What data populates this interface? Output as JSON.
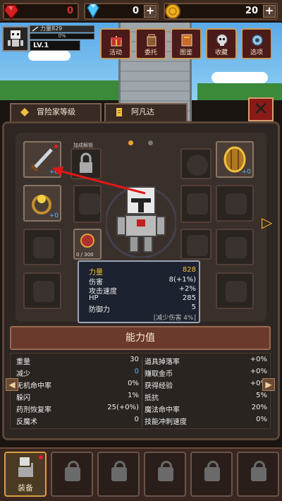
{
  "resources": {
    "gems": "0",
    "diamonds": "0",
    "coins": "20"
  },
  "profile": {
    "stat_name": "力量",
    "stat_value": "829",
    "xp_percent": "0%",
    "level": "LV.1"
  },
  "menu": [
    {
      "label": "活动",
      "icon": "gift-icon"
    },
    {
      "label": "委托",
      "icon": "backpack-icon"
    },
    {
      "label": "图鉴",
      "icon": "book-icon"
    },
    {
      "label": "收藏",
      "icon": "skull-icon"
    },
    {
      "label": "选项",
      "icon": "gear-icon"
    }
  ],
  "tabs": {
    "adventurer": "冒险家等级",
    "name": "阿凡达"
  },
  "equipment": {
    "sword_plus": "+0",
    "shield_plus": "+0",
    "ring_plus": "+0",
    "unlock_text": "加成解锁",
    "potion_count": "0 / 300"
  },
  "tooltip": {
    "title": "力量",
    "title_value": "828",
    "rows": [
      {
        "k": "伤害",
        "v": "8(+1%)"
      },
      {
        "k": "攻击速度",
        "v": "+2%"
      },
      {
        "k": "HP",
        "v": "285"
      },
      {
        "k": "防御力",
        "v": "5"
      }
    ],
    "note": "[减少伤害 4%]"
  },
  "ability": {
    "header": "能力值",
    "left": [
      {
        "k": "重量",
        "v": "30"
      },
      {
        "k": "减少",
        "v": "0"
      },
      {
        "k": "无机命中率",
        "v": "0%"
      },
      {
        "k": "躲闪",
        "v": "1%"
      },
      {
        "k": "药剂恢复率",
        "v": "25(+0%)"
      },
      {
        "k": "反魔术",
        "v": "0"
      }
    ],
    "right": [
      {
        "k": "道具掉落率",
        "v": "+0%"
      },
      {
        "k": "赚取金币",
        "v": "+0%"
      },
      {
        "k": "获得经验",
        "v": "+0%"
      },
      {
        "k": "抵抗",
        "v": "5%"
      },
      {
        "k": "魔法命中率",
        "v": "20%"
      },
      {
        "k": "技能冲刺速度",
        "v": "0%"
      }
    ]
  },
  "bottom": {
    "equip_label": "装备"
  },
  "colors": {
    "accent_gold": "#f4c030",
    "blue_value": "#5ab4ff",
    "green_value": "#5ad05a"
  }
}
